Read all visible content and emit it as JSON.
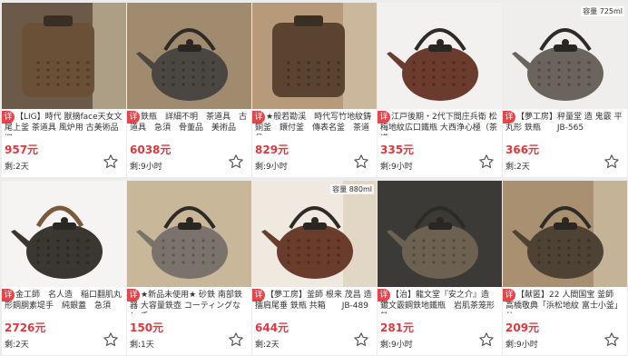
{
  "listings": [
    {
      "tag": "详",
      "title": "【LIG】時代 獣摘face天女文 尾上釜 茶道具 風炉用 古美術品 旧…",
      "price": "957元",
      "remaining": "剩:2天",
      "capacity": ""
    },
    {
      "tag": "详",
      "title": "鉄瓶　詳細不明　茶道具　古道具　急須　骨董品　美術品",
      "price": "6038元",
      "remaining": "剩:9小时",
      "capacity": ""
    },
    {
      "tag": "详",
      "title": "★般若勘渓　時代写竹地紋鋳銅釜　鐶付釜　傳表名釜　茶道具",
      "price": "829元",
      "remaining": "剩:9小时",
      "capacity": ""
    },
    {
      "tag": "详",
      "title": "江戸後期・2代下間庄兵衛 松梅地紋広口鐵瓶 大西浄心極（茶道…",
      "price": "335元",
      "remaining": "剩:9小时",
      "capacity": ""
    },
    {
      "tag": "详",
      "title": "【夢工房】秤量堂 造 鬼霰 平丸形 鉄瓶　　JB-565",
      "price": "366元",
      "remaining": "剩:2天",
      "capacity": "容量 725ml"
    },
    {
      "tag": "详",
      "title": "金工師　名人造　稲口翻肌丸形鋼胴素堤手　純銀蓋　急須",
      "price": "2726元",
      "remaining": "剩:2天",
      "capacity": ""
    },
    {
      "tag": "详",
      "title": "★新品未使用★ 砂鉄 南部鉄器 大容量鉄壺 コーティングなし 手…",
      "price": "150元",
      "remaining": "剩:1天",
      "capacity": ""
    },
    {
      "tag": "详",
      "title": "【夢工房】釜師 根来 茂昌 造 擂肩尾垂 鉄瓶 共箱　　JB-489",
      "price": "644元",
      "remaining": "剩:2天",
      "capacity": "容量 880ml"
    },
    {
      "tag": "详",
      "title": "【治】龍文堂『安之介』造　鍍文霰鋼鉄地鐵瓶　岩肌茶笼形鉄…",
      "price": "281元",
      "remaining": "剩:9小时",
      "capacity": ""
    },
    {
      "tag": "详",
      "title": "【献匿】22 人間国宝 釜師 高橋敬典「浜松地紋 富士小釜」共…",
      "price": "209元",
      "remaining": "剩:9小时",
      "capacity": ""
    }
  ],
  "colors": {
    "accent": "#e0383e",
    "tag_bg": "#e8454a",
    "background": "#ececec"
  }
}
